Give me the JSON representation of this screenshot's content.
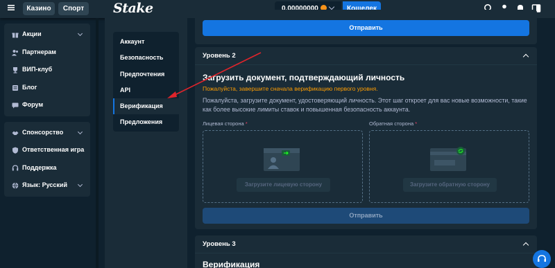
{
  "topbar": {
    "casino_label": "Казино",
    "sport_label": "Спорт",
    "logo": "Stake",
    "balance": "0.00000000",
    "wallet_label": "Кошелек"
  },
  "sidebar": {
    "group1": [
      {
        "label": "Акции",
        "icon": "gift-icon",
        "has_caret": true
      },
      {
        "label": "Партнерам",
        "icon": "partners-icon",
        "has_caret": false
      },
      {
        "label": "ВИП-клуб",
        "icon": "trophy-icon",
        "has_caret": false
      },
      {
        "label": "Блог",
        "icon": "blog-icon",
        "has_caret": false
      },
      {
        "label": "Форум",
        "icon": "forum-icon",
        "has_caret": false
      }
    ],
    "group2": [
      {
        "label": "Спонсорство",
        "icon": "handshake-icon",
        "has_caret": true
      },
      {
        "label": "Ответственная игра",
        "icon": "shield-icon",
        "has_caret": false
      },
      {
        "label": "Поддержка",
        "icon": "headset-icon",
        "has_caret": false
      },
      {
        "label": "Язык: Русский",
        "icon": "globe-icon",
        "has_caret": true
      }
    ]
  },
  "settings_menu": {
    "items": [
      "Аккаунт",
      "Безопасность",
      "Предпочтения",
      "API",
      "Верификация",
      "Предложения"
    ],
    "active": "Верификация"
  },
  "main": {
    "top_submit_label": "Отправить",
    "level2": {
      "header": "Уровень 2",
      "title": "Загрузить документ, подтверждающий личность",
      "warning": "Пожалуйста, завершите сначала верификацию первого уровня.",
      "description": "Пожалуйста, загрузите документ, удостоверяющий личность. Этот шаг откроет для вас новые возможности, такие как более высокие лимиты ставок и повышенная безопасность аккаунта.",
      "front_label": "Лицевая сторона",
      "back_label": "Обратная сторона",
      "required_mark": "*",
      "front_upload": "Загрузите лицевую сторону",
      "back_upload": "Загрузите обратную сторону",
      "submit_label": "Отправить"
    },
    "level3": {
      "header": "Уровень 3",
      "title": "Верификация"
    }
  },
  "colors": {
    "bg": "#0f212e",
    "panel": "#1a2c38",
    "accent": "#1475e1",
    "warning": "#ff9d00",
    "annotation": "#e0242b"
  }
}
